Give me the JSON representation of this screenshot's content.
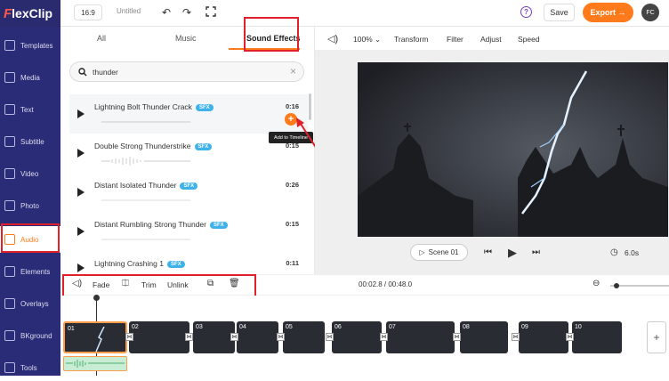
{
  "app": {
    "logo": "lexClip",
    "logo_initial": "F"
  },
  "header": {
    "ratio": "16:9",
    "title": "Untitled",
    "help": "?",
    "save_label": "Save",
    "export_label": "Export →",
    "avatar": "FC"
  },
  "sidebar": {
    "items": [
      {
        "label": "Templates",
        "icon": "templates-icon"
      },
      {
        "label": "Media",
        "icon": "media-icon"
      },
      {
        "label": "Text",
        "icon": "text-icon"
      },
      {
        "label": "Subtitle",
        "icon": "subtitle-icon"
      },
      {
        "label": "Video",
        "icon": "video-icon"
      },
      {
        "label": "Photo",
        "icon": "photo-icon"
      },
      {
        "label": "Audio",
        "icon": "audio-icon",
        "active": true
      },
      {
        "label": "Elements",
        "icon": "elements-icon"
      },
      {
        "label": "Overlays",
        "icon": "overlays-icon"
      },
      {
        "label": "BKground",
        "icon": "background-icon"
      },
      {
        "label": "Tools",
        "icon": "tools-icon"
      }
    ]
  },
  "audio_panel": {
    "tabs": [
      {
        "label": "All"
      },
      {
        "label": "Music"
      },
      {
        "label": "Sound Effects",
        "active": true
      }
    ],
    "search": {
      "value": "thunder",
      "clear": "×"
    },
    "tracks": [
      {
        "name": "Lightning Bolt Thunder Crack",
        "badge": "SFX",
        "duration": "0:16"
      },
      {
        "name": "Double Strong Thunderstrike",
        "badge": "SFX",
        "duration": "0:15"
      },
      {
        "name": "Distant Isolated Thunder",
        "badge": "SFX",
        "duration": "0:26"
      },
      {
        "name": "Distant Rumbling Strong Thunder",
        "badge": "SFX",
        "duration": "0:15"
      },
      {
        "name": "Lightning Crashing 1",
        "badge": "SFX",
        "duration": "0:11"
      }
    ],
    "add_tooltip": "Add to Timeline",
    "add_symbol": "+"
  },
  "video_toolbar": {
    "zoom": "100%",
    "items": [
      "Transform",
      "Filter",
      "Adjust",
      "Speed"
    ]
  },
  "preview": {
    "scene_label": "Scene 01",
    "duration": "6.0s"
  },
  "edit_toolbar": {
    "fade": "Fade",
    "trim": "Trim",
    "unlink": "Unlink",
    "time": "00:02.8 / 00:48.0"
  },
  "timeline": {
    "clips": [
      "01",
      "02",
      "03",
      "04",
      "05",
      "06",
      "07",
      "08",
      "09",
      "10"
    ]
  },
  "colors": {
    "accent": "#ff7a1a",
    "sidebar": "#2b2c77",
    "sfx_badge": "#3fb2ea",
    "highlight": "#e0202a"
  }
}
